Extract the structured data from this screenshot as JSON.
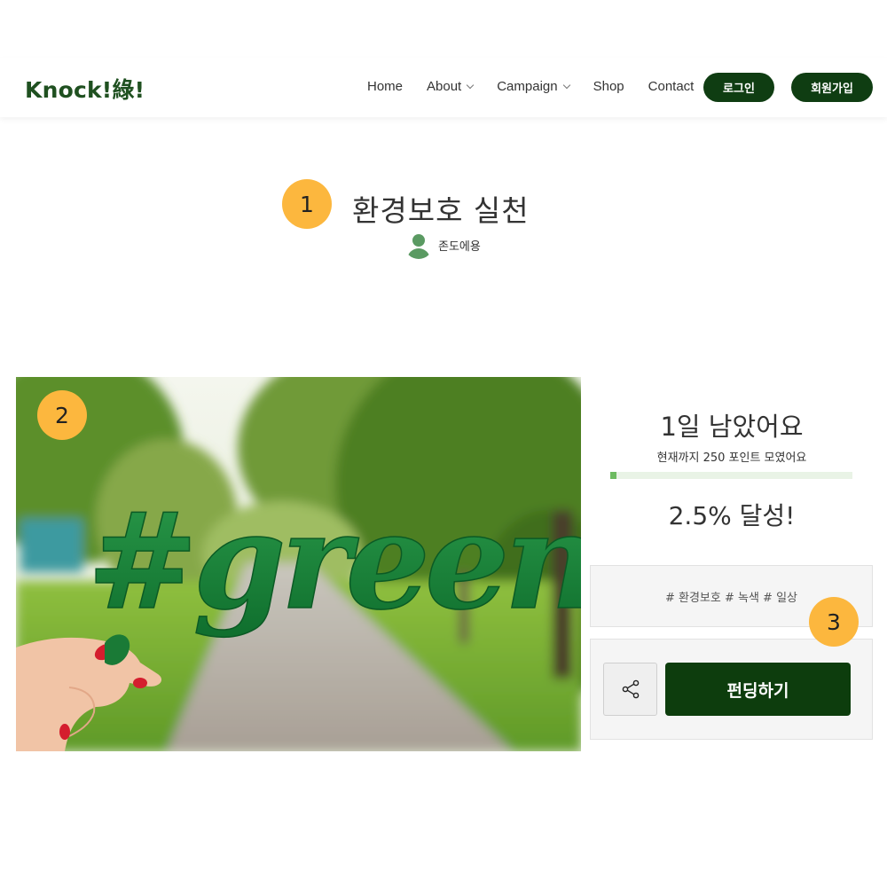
{
  "header": {
    "logo": "Knock!綠!",
    "nav": [
      {
        "label": "Home",
        "has_dropdown": false
      },
      {
        "label": "About",
        "has_dropdown": true
      },
      {
        "label": "Campaign",
        "has_dropdown": true
      },
      {
        "label": "Shop",
        "has_dropdown": false
      },
      {
        "label": "Contact",
        "has_dropdown": false
      }
    ],
    "login_label": "로그인",
    "signup_label": "회원가입"
  },
  "badges": {
    "one": "1",
    "two": "2",
    "three": "3"
  },
  "post": {
    "title": "환경보호 실천",
    "author": "존도에용"
  },
  "photo": {
    "overlay_text": "#green"
  },
  "campaign": {
    "days_left": "1일 남았어요",
    "points_text": "현재까지 250 포인트 모였어요",
    "progress": 0.025,
    "achievement": "2.5% 달성!",
    "tags": "# 환경보호 # 녹색 # 일상",
    "fund_label": "펀딩하기"
  },
  "colors": {
    "brand_dark_green": "#0f3d12",
    "badge_yellow": "#fcb73e",
    "progress_fill": "#6dbb60",
    "progress_track": "#e9f3e6"
  },
  "icons": {
    "share": "share-icon",
    "user": "user-icon",
    "chevron": "chevron-down-icon"
  }
}
